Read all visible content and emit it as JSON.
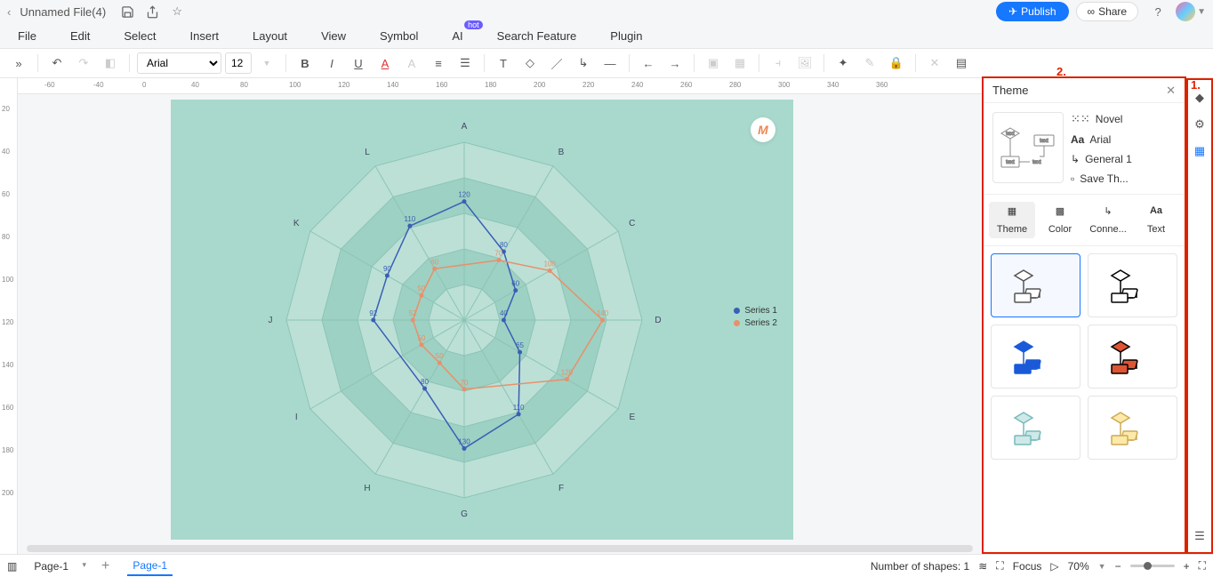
{
  "header": {
    "filename": "Unnamed File(4)",
    "publish": "Publish",
    "share": "Share"
  },
  "menu": {
    "file": "File",
    "edit": "Edit",
    "select": "Select",
    "insert": "Insert",
    "layout": "Layout",
    "view": "View",
    "symbol": "Symbol",
    "ai": "AI",
    "ai_badge": "hot",
    "search": "Search Feature",
    "plugin": "Plugin"
  },
  "toolbar": {
    "font": "Arial",
    "size": "12"
  },
  "ruler_h": [
    "-60",
    "-40",
    "0",
    "40",
    "80",
    "100",
    "120",
    "140",
    "160",
    "180",
    "200",
    "220",
    "240",
    "260",
    "280",
    "300",
    "340",
    "360"
  ],
  "ruler_v": [
    "20",
    "40",
    "60",
    "80",
    "100",
    "120",
    "140",
    "160",
    "180",
    "200"
  ],
  "chart_data": {
    "type": "radar",
    "categories": [
      "A",
      "B",
      "C",
      "D",
      "E",
      "F",
      "G",
      "H",
      "I",
      "J",
      "K",
      "L"
    ],
    "series": [
      {
        "name": "Series 1",
        "color": "#3a5fb5",
        "values": [
          120,
          80,
          60,
          40,
          65,
          110,
          130,
          80,
          null,
          92,
          90,
          110
        ],
        "labels": [
          "120",
          "80",
          "60",
          "40",
          "65",
          "110",
          "130",
          "80",
          "",
          "92",
          "90",
          "110"
        ]
      },
      {
        "name": "Series 2",
        "color": "#e8906a",
        "values": [
          null,
          70,
          100,
          140,
          120,
          null,
          70,
          50,
          50,
          52,
          50,
          60
        ],
        "labels": [
          "",
          "70",
          "100",
          "140",
          "120",
          "",
          "70",
          "50",
          "50",
          "52",
          "50",
          "60"
        ]
      }
    ],
    "rings": 5,
    "max": 180
  },
  "theme_panel": {
    "title": "Theme",
    "props": {
      "novel": "Novel",
      "font": "Arial",
      "connector": "General 1",
      "save": "Save Th..."
    },
    "tabs": {
      "theme": "Theme",
      "color": "Color",
      "connector": "Conne...",
      "text": "Text"
    },
    "theme_colors": [
      {
        "stroke": "#555",
        "fill": "#fff"
      },
      {
        "stroke": "#000",
        "fill": "#fff"
      },
      {
        "stroke": "#1a5ad9",
        "fill": "#1a5ad9"
      },
      {
        "stroke": "#000",
        "fill": "#d53"
      },
      {
        "stroke": "#7bb",
        "fill": "#cfe8e8"
      },
      {
        "stroke": "#ca5",
        "fill": "#ffe9a8"
      }
    ]
  },
  "annotations": {
    "one": "1.",
    "two": "2."
  },
  "status": {
    "page_dd": "Page-1",
    "page_tab": "Page-1",
    "shapes_label": "Number of shapes: 1",
    "focus": "Focus",
    "zoom": "70%"
  }
}
